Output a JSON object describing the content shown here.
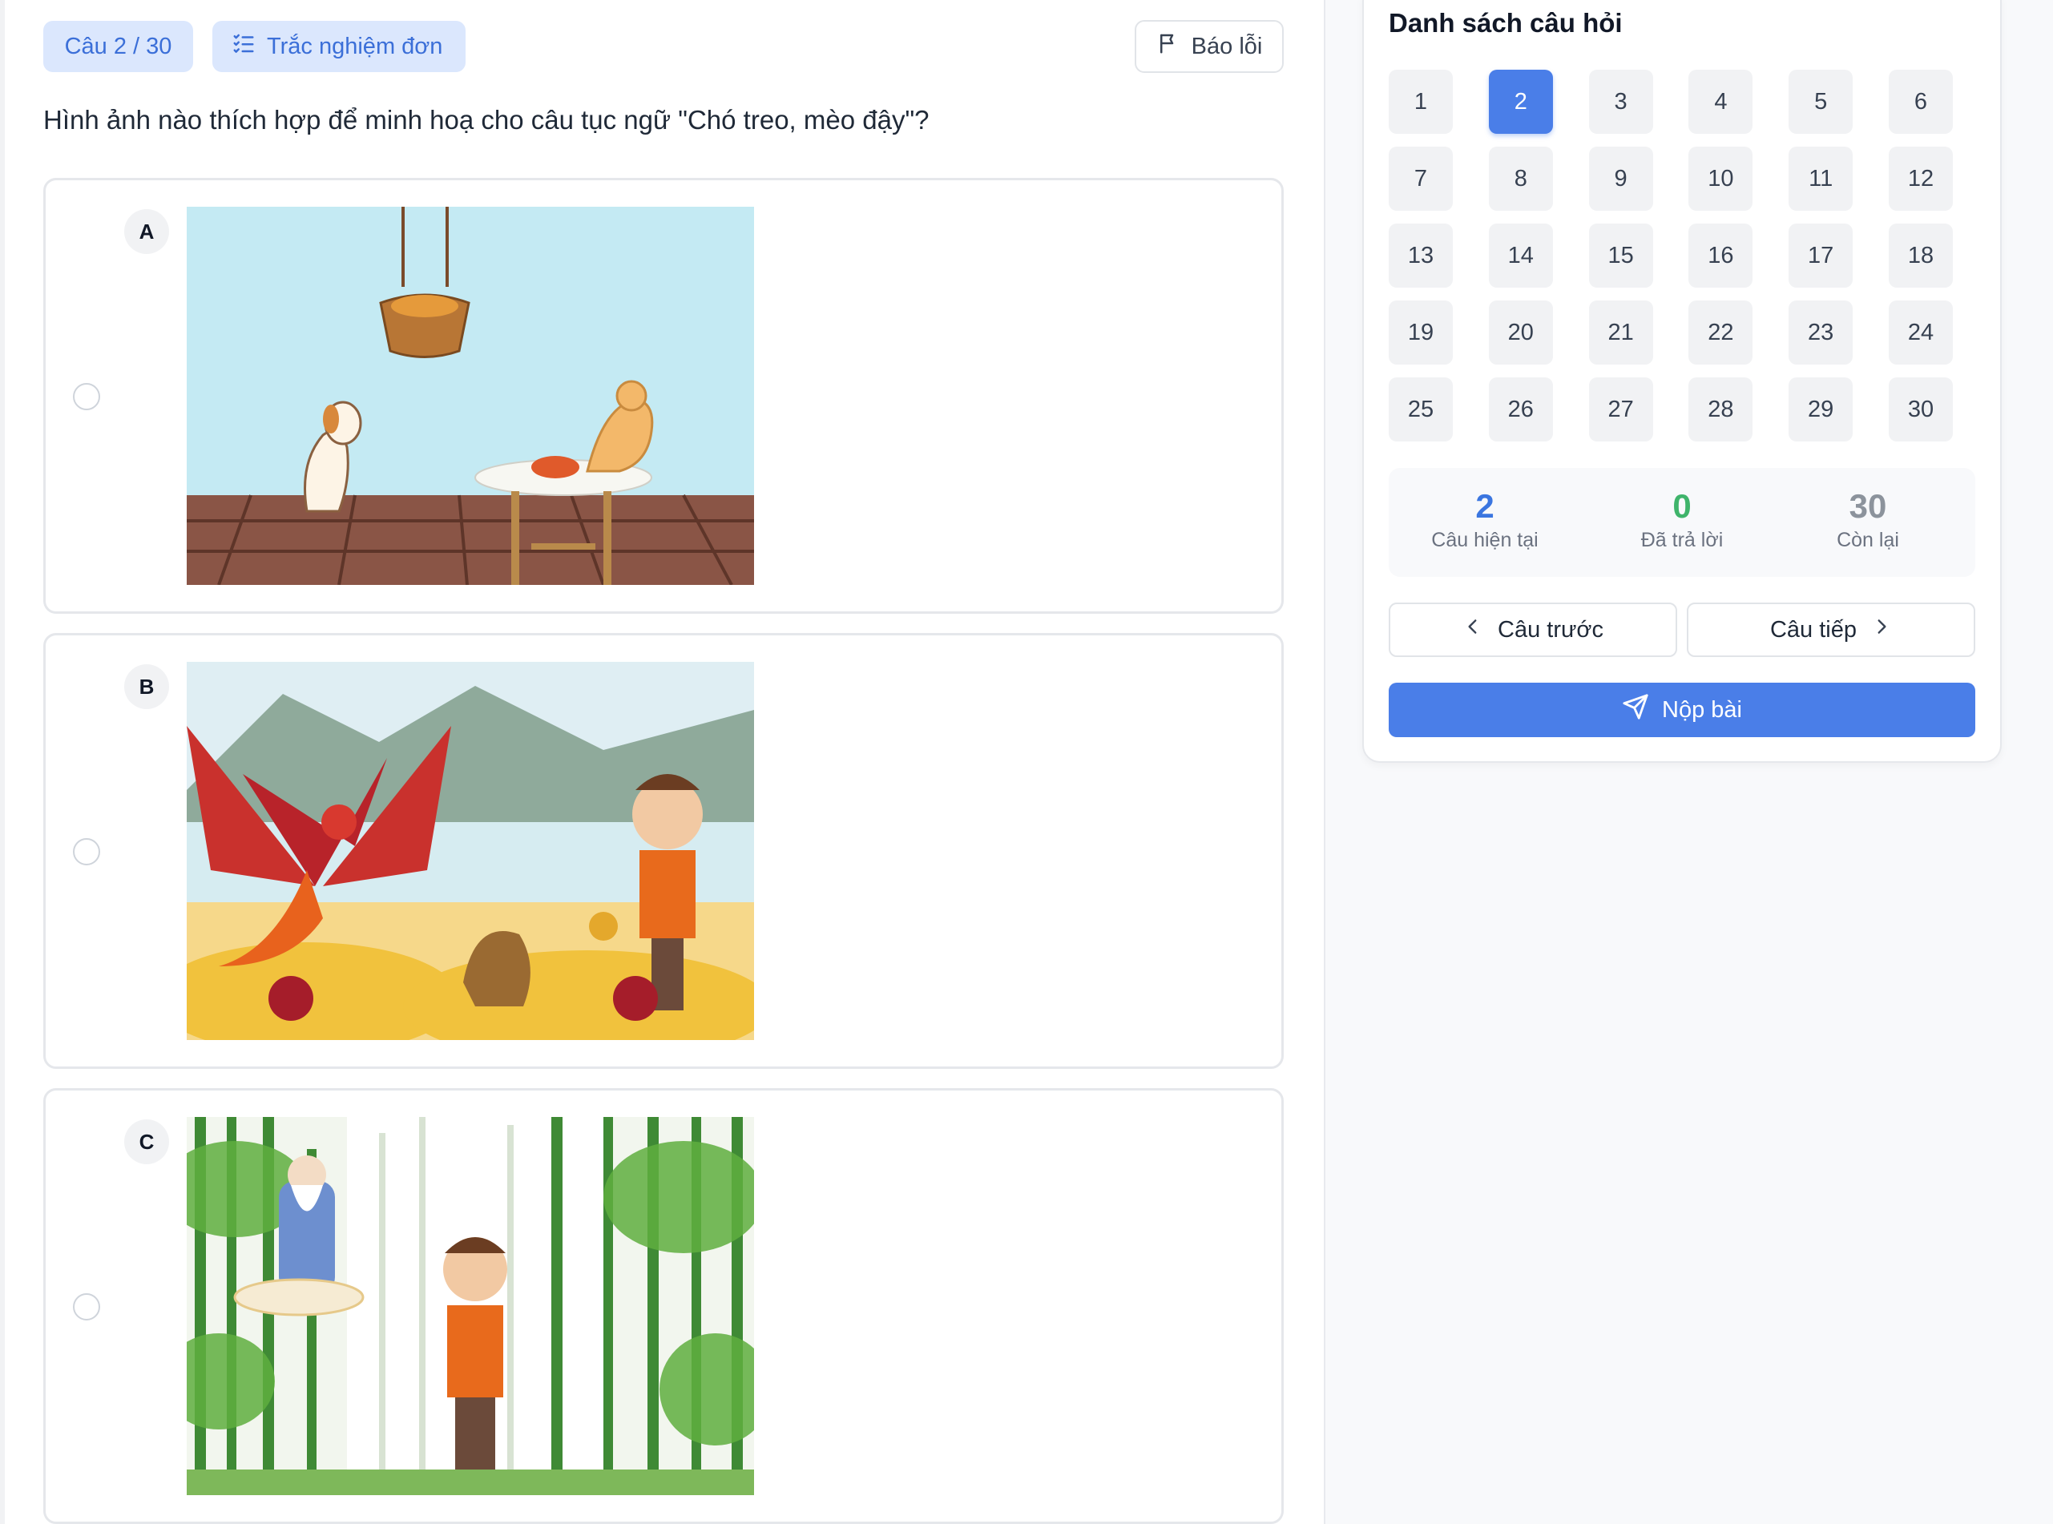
{
  "header": {
    "question_counter": "Câu 2 / 30",
    "question_type": "Trắc nghiệm đơn",
    "report_label": "Báo lỗi"
  },
  "question": {
    "text": "Hình ảnh nào thích hợp để minh hoạ cho câu tục ngữ \"Chó treo, mèo đậy\"?"
  },
  "options": [
    {
      "letter": "A",
      "image": "dog-and-cat-illustration"
    },
    {
      "letter": "B",
      "image": "phoenix-and-treasure-illustration"
    },
    {
      "letter": "C",
      "image": "bamboo-forest-illustration"
    }
  ],
  "sidebar": {
    "title": "Danh sách câu hỏi",
    "questions": [
      "1",
      "2",
      "3",
      "4",
      "5",
      "6",
      "7",
      "8",
      "9",
      "10",
      "11",
      "12",
      "13",
      "14",
      "15",
      "16",
      "17",
      "18",
      "19",
      "20",
      "21",
      "22",
      "23",
      "24",
      "25",
      "26",
      "27",
      "28",
      "29",
      "30"
    ],
    "active_question": "2",
    "stats": {
      "current": {
        "value": "2",
        "label": "Câu hiện tại"
      },
      "answered": {
        "value": "0",
        "label": "Đã trả lời"
      },
      "remaining": {
        "value": "30",
        "label": "Còn lại"
      }
    },
    "prev_label": "Câu trước",
    "next_label": "Câu tiếp",
    "submit_label": "Nộp bài"
  },
  "colors": {
    "accent": "#4a7ee8",
    "tag_bg": "#dbe7fd",
    "answered_green": "#3fb46b",
    "remaining_gray": "#8c939c"
  }
}
